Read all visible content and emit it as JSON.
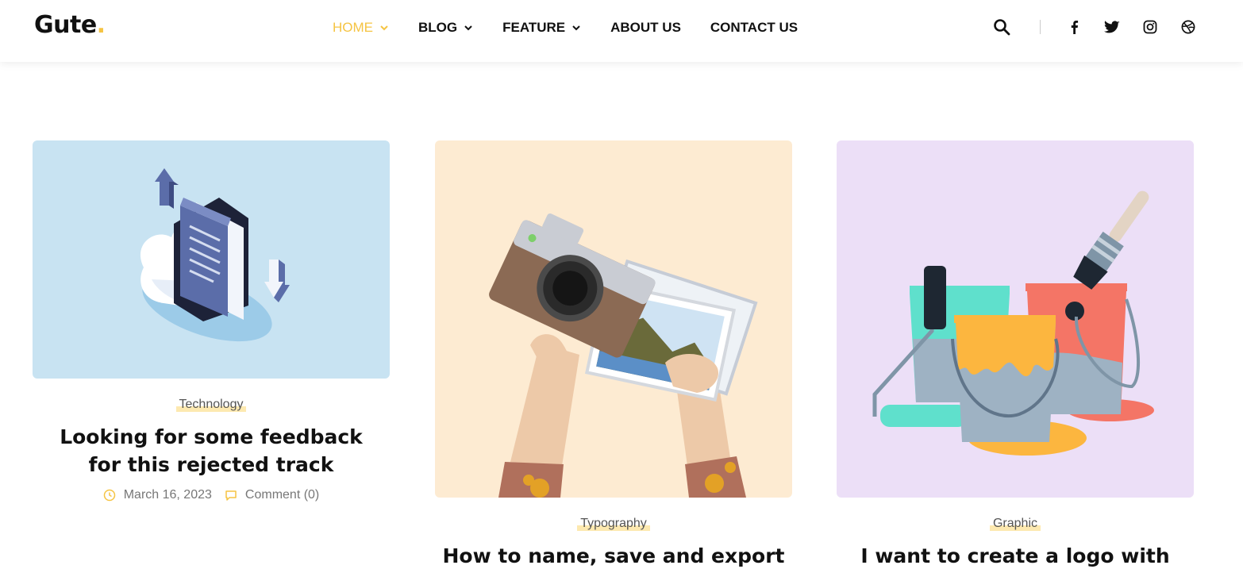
{
  "brand": {
    "name": "Gute",
    "dot": ".",
    "accent": "#f5c443"
  },
  "nav": {
    "items": [
      {
        "label": "HOME",
        "dropdown": true,
        "active": true
      },
      {
        "label": "BLOG",
        "dropdown": true,
        "active": false
      },
      {
        "label": "FEATURE",
        "dropdown": true,
        "active": false
      },
      {
        "label": "ABOUT US",
        "dropdown": false,
        "active": false
      },
      {
        "label": "CONTACT US",
        "dropdown": false,
        "active": false
      }
    ]
  },
  "header_tools": {
    "icons": [
      "search-icon",
      "facebook-icon",
      "twitter-icon",
      "instagram-icon",
      "dribbble-icon"
    ]
  },
  "posts": [
    {
      "category": "Technology",
      "title_lines": [
        "Looking for some feedback",
        "for this rejected track"
      ],
      "date": "March 16, 2023",
      "comments": "Comment (0)",
      "image_bg": "#c8e3f2",
      "image_subject": "cloud-documents-illustration"
    },
    {
      "category": "Typography",
      "title_lines": [
        "How to name, save and export"
      ],
      "image_bg": "#fdebd2",
      "image_subject": "camera-photos-illustration"
    },
    {
      "category": "Graphic",
      "title_lines": [
        "I want to create a logo with"
      ],
      "image_bg": "#ecdff7",
      "image_subject": "paint-buckets-illustration"
    }
  ]
}
